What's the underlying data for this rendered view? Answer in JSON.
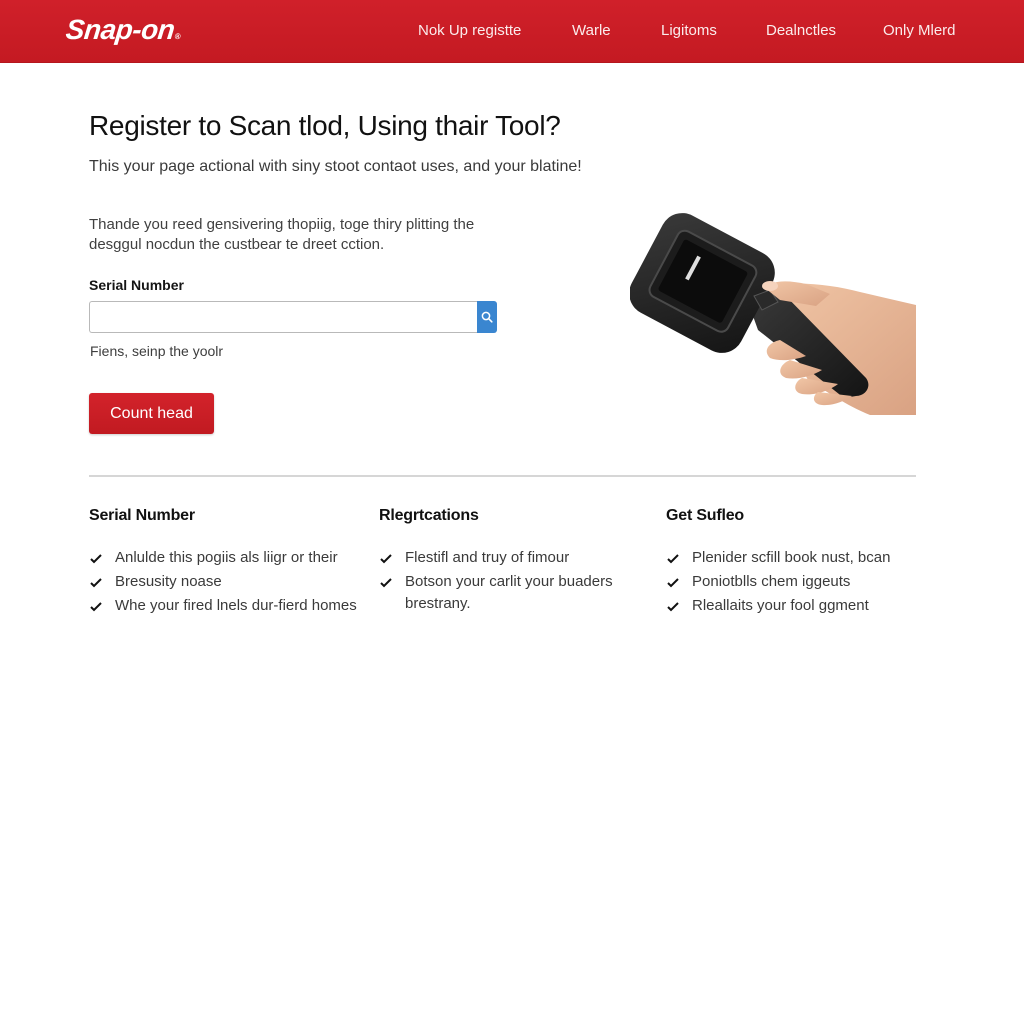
{
  "header": {
    "logo_text": "Snap-on",
    "logo_mark": "®",
    "nav": [
      {
        "label": "Nok Up registte"
      },
      {
        "label": "Warle"
      },
      {
        "label": "Ligitoms"
      },
      {
        "label": "Dealnctles"
      },
      {
        "label": "Only Mlerd"
      }
    ]
  },
  "colors": {
    "brand_red": "#c81d25",
    "search_blue": "#3a86d0"
  },
  "main": {
    "title": "Register to Scan tlod, Using thair Tool?",
    "subtitle": "This your page actional with siny stoot contaot uses, and your blatine!",
    "description": "Thande you reed gensivering thopiig, toge thiry plitting the desggul nocdun the custbear te dreet cction.",
    "serial_field": {
      "label": "Serial Number",
      "value": "",
      "placeholder": "",
      "search_icon": "search-icon"
    },
    "hint": "Fiens, seinp the yoolr",
    "cta_label": "Count head",
    "hero_image_alt": "hand holding scan tool"
  },
  "features": [
    {
      "heading": "Serial Number",
      "items": [
        "Anlulde this pogiis als liigr or their",
        "Bresusity noase",
        "Whe your fired lnels dur-fierd homes"
      ]
    },
    {
      "heading": "Rlegrtcations",
      "items": [
        "Flestifl and truy of fimour",
        "Botson your carlit your buaders brestrany."
      ]
    },
    {
      "heading": "Get Sufleo",
      "items": [
        "Plenider scfill book nust, bcan",
        "Poniotblls chem iggeuts",
        "Rleallaits your fool ggment"
      ]
    }
  ]
}
